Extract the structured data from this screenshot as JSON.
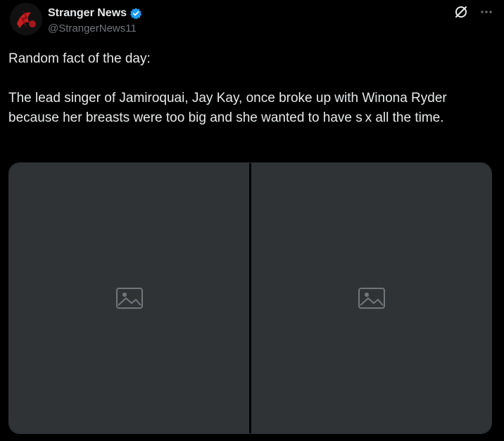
{
  "author": {
    "display_name": "Stranger News",
    "handle": "@StrangerNews11",
    "verified": true
  },
  "post": {
    "lines": [
      "Random fact of the day:",
      "",
      "The lead singer of Jamiroquai, Jay Kay, once broke up with Winona Ryder because her breasts were too big and she wanted to have s x all the time."
    ]
  },
  "media": {
    "count": 2
  },
  "colors": {
    "background": "#000000",
    "text": "#e7e9ea",
    "secondary_text": "#71767b",
    "verified_badge": "#1d9bf0",
    "border": "#2f3336"
  },
  "icons": {
    "avatar": "avatar-logo",
    "verified": "verified-badge-icon",
    "grok": "grok-icon",
    "more": "more-dots-icon"
  }
}
